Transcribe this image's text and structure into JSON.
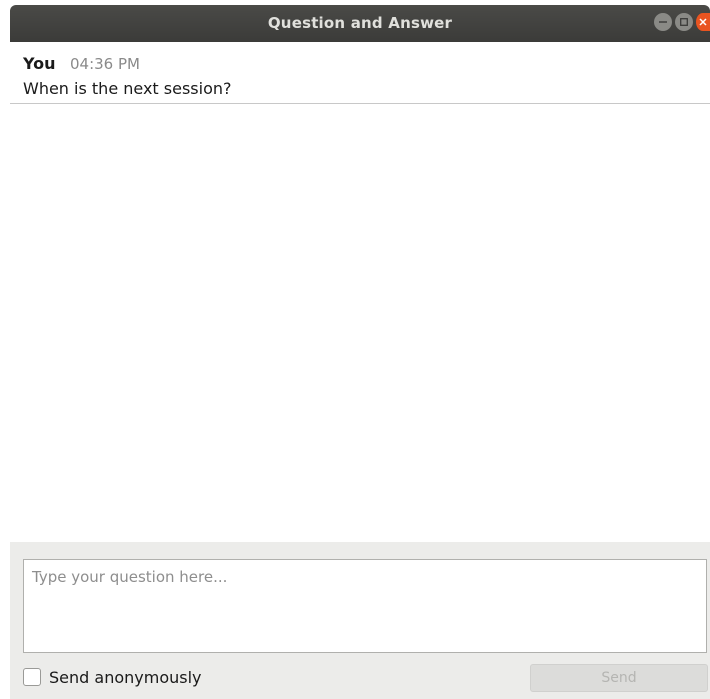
{
  "window": {
    "title": "Question and Answer",
    "controls": [
      "minimize-icon",
      "maximize-icon",
      "close-icon"
    ]
  },
  "messages": [
    {
      "author": "You",
      "time": "04:36 PM",
      "text": "When is the next session?"
    }
  ],
  "compose": {
    "placeholder": "Type your question here...",
    "value": "",
    "anonymous_label": "Send anonymously",
    "anonymous_checked": false,
    "send_label": "Send",
    "send_enabled": false
  },
  "colors": {
    "titlebar": "#3b3b39",
    "close_button": "#e95420",
    "compose_background": "#ececea",
    "send_disabled": "#dcdcda"
  }
}
